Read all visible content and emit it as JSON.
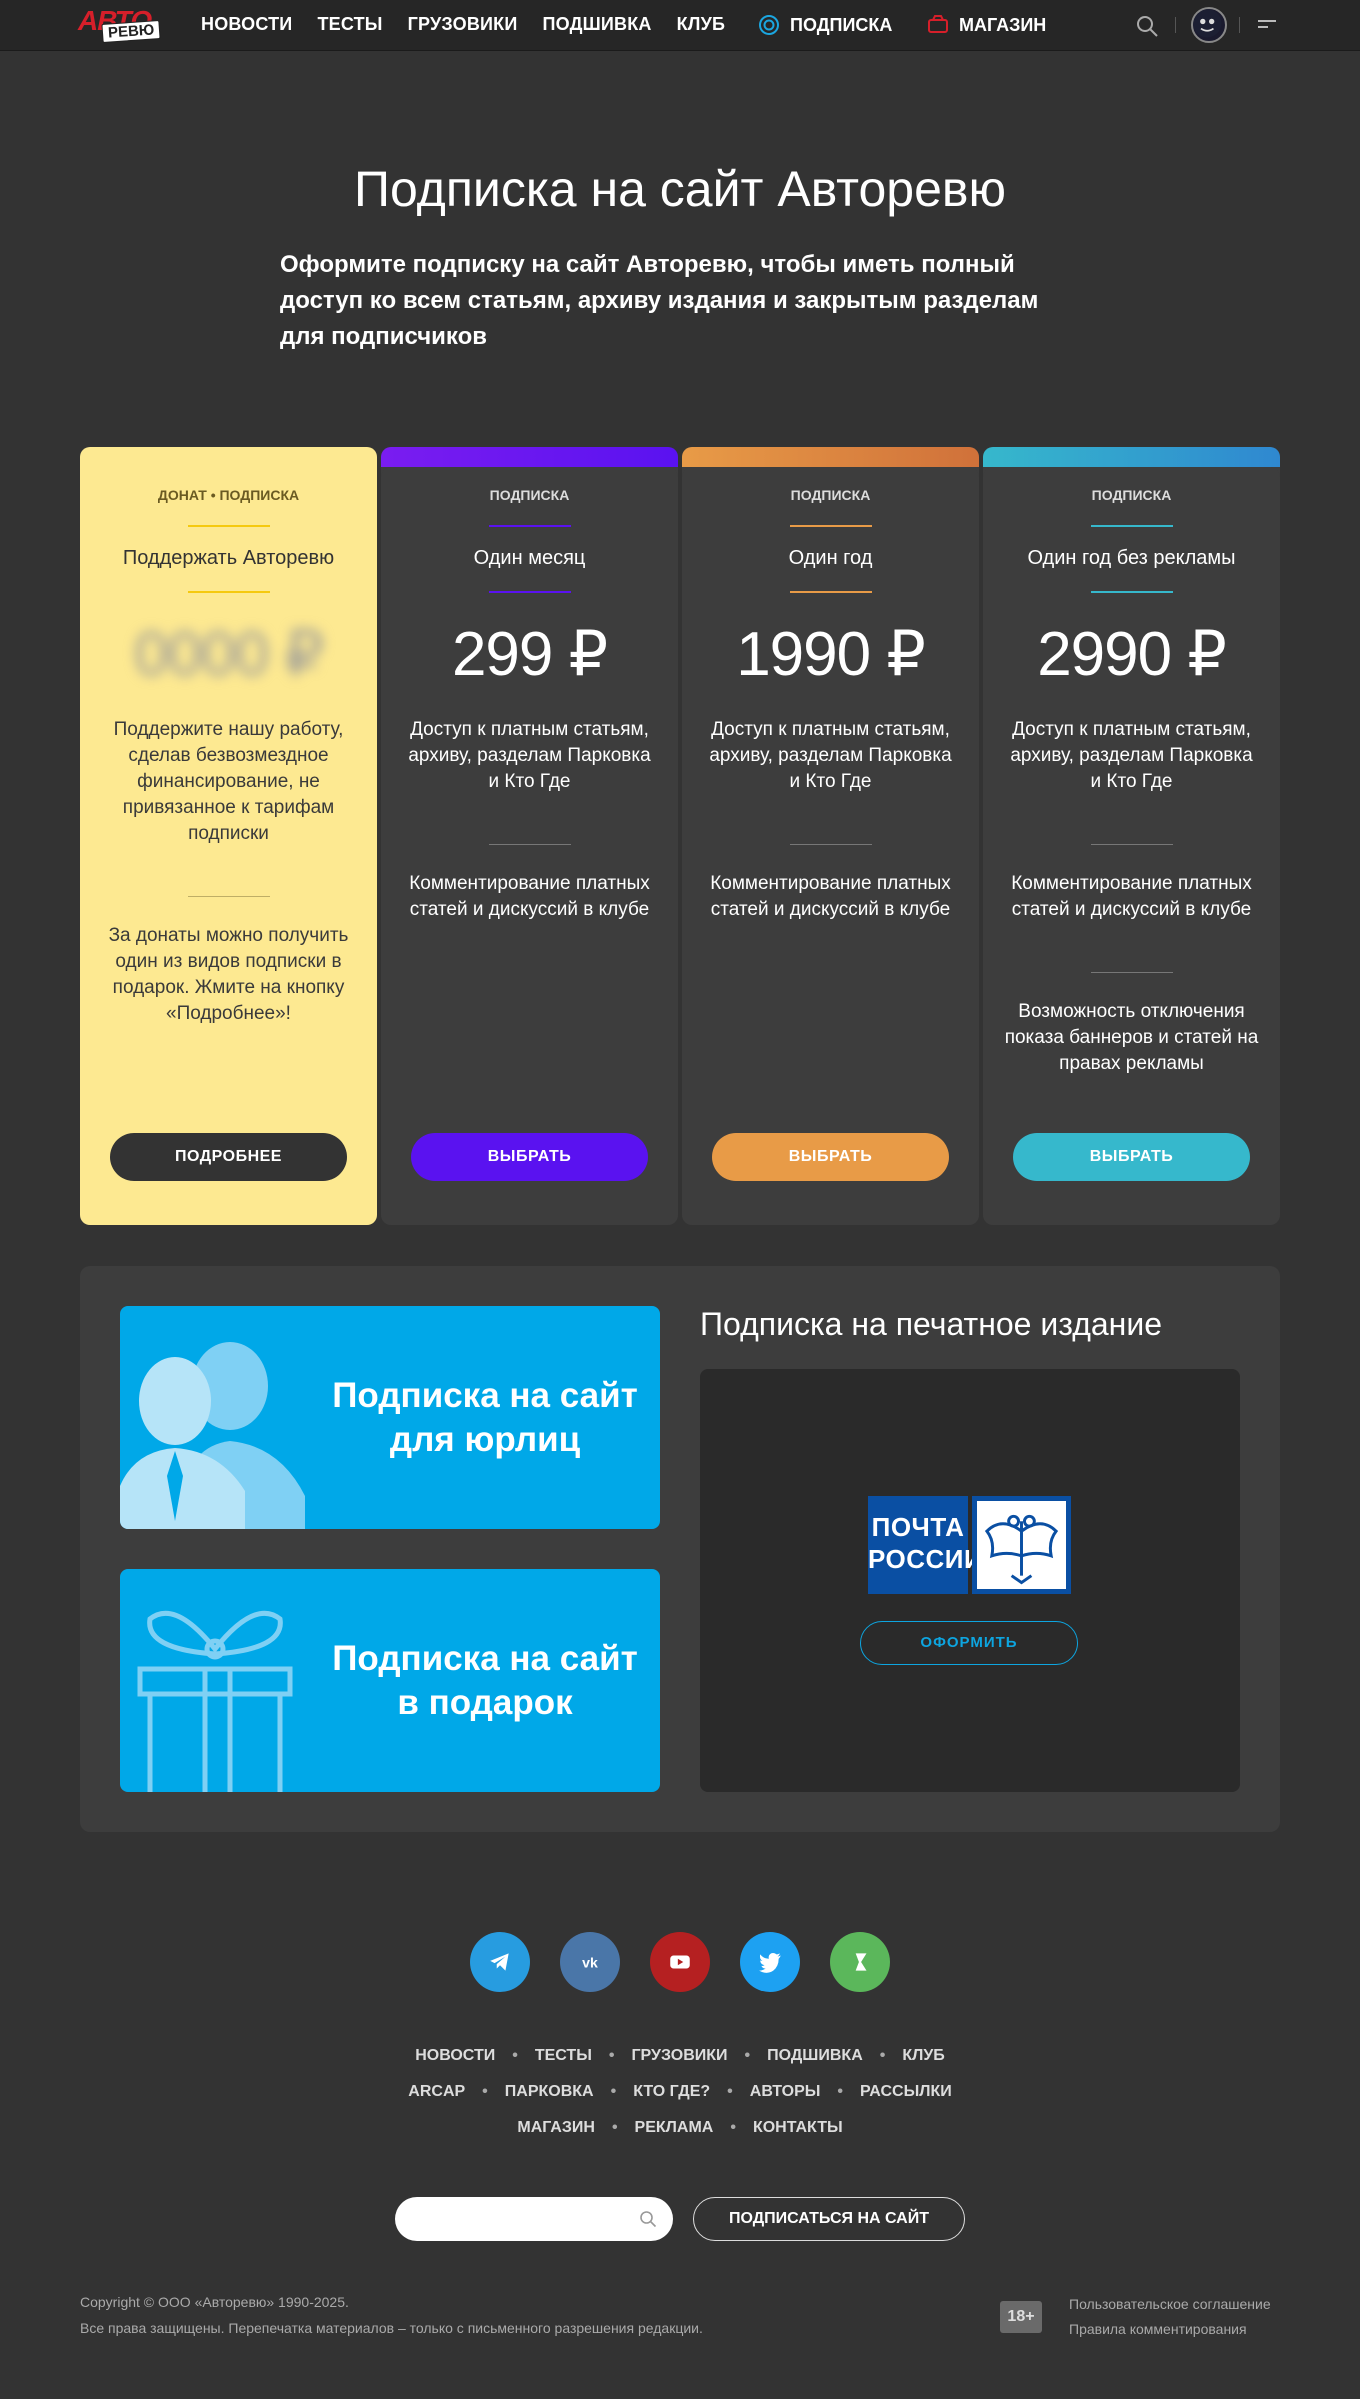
{
  "header": {
    "logo_top": "АВТО",
    "logo_bottom": "РЕВЮ",
    "nav": [
      "НОВОСТИ",
      "ТЕСТЫ",
      "ГРУЗОВИКИ",
      "ПОДШИВКА",
      "КЛУБ"
    ],
    "subscription_label": "ПОДПИСКА",
    "shop_label": "МАГАЗИН",
    "accent_subscription": "#1ba6e0",
    "accent_shop": "#d61f2a"
  },
  "hero": {
    "title": "Подписка на сайт Авторевю",
    "description": "Оформите подписку на сайт Авторевю, чтобы иметь полный доступ ко всем статьям, архиву издания и закрытым разделам для подписчиков"
  },
  "cards": [
    {
      "tag": "ДОНАТ • ПОДПИСКА",
      "name": "Поддержать Авторевю",
      "price": "0000 ₽",
      "text1": "Поддержите нашу работу, сделав безвозмездное финансирование, не привязанное к тарифам подписки",
      "text2": "За донаты можно получить один из видов подписки в подарок. Жмите на кнопку «Подробнее»!",
      "button": "ПОДРОБНЕЕ",
      "accent": "#f5c90f"
    },
    {
      "tag": "ПОДПИСКА",
      "name": "Один месяц",
      "price": "299 ₽",
      "text1": "Доступ к платным статьям, архиву, разделам Парковка и Кто Где",
      "text2": "Комментирование платных статей и дискуссий в клубе",
      "button": "ВЫБРАТЬ",
      "accent": "#5a12f0"
    },
    {
      "tag": "ПОДПИСКА",
      "name": "Один год",
      "price": "1990 ₽",
      "text1": "Доступ к платным статьям, архиву, разделам Парковка и Кто Где",
      "text2": "Комментирование платных статей и дискуссий в клубе",
      "button": "ВЫБРАТЬ",
      "accent": "#e89b47"
    },
    {
      "tag": "ПОДПИСКА",
      "name": "Один год без рекламы",
      "price": "2990 ₽",
      "text1": "Доступ к платным статьям, архиву, разделам Парковка и Кто Где",
      "text2": "Комментирование платных статей и дискуссий в клубе",
      "text3": "Возможность отключения показа баннеров и статей на правах рекламы",
      "button": "ВЫБРАТЬ",
      "accent": "#36b8cc"
    }
  ],
  "promos": {
    "legal": "Подписка на сайт для юрлиц",
    "gift": "Подписка на сайт в подарок"
  },
  "print": {
    "title": "Подписка на печатное издание",
    "logo_text": "ПОЧТА РОССИИ",
    "button": "ОФОРМИТЬ"
  },
  "footer": {
    "socials": [
      "telegram-icon",
      "vk-icon",
      "youtube-icon",
      "twitter-icon",
      "yandex-zen-icon"
    ],
    "nav_row1": [
      "НОВОСТИ",
      "ТЕСТЫ",
      "ГРУЗОВИКИ",
      "ПОДШИВКА",
      "КЛУБ"
    ],
    "nav_row2": [
      "ARCAP",
      "ПАРКОВКА",
      "КТО ГДЕ?",
      "АВТОРЫ",
      "РАССЫЛКИ"
    ],
    "nav_row3": [
      "МАГАЗИН",
      "РЕКЛАМА",
      "КОНТАКТЫ"
    ],
    "subscribe_button": "ПОДПИСАТЬСЯ НА САЙТ",
    "copyright1": "Copyright © ООО «Авторевю» 1990-2025.",
    "copyright2": "Все права защищены. Перепечатка материалов – только с письменного разрешения редакции.",
    "age": "18+",
    "link1": "Пользовательское соглашение",
    "link2": "Правила комментирования"
  }
}
